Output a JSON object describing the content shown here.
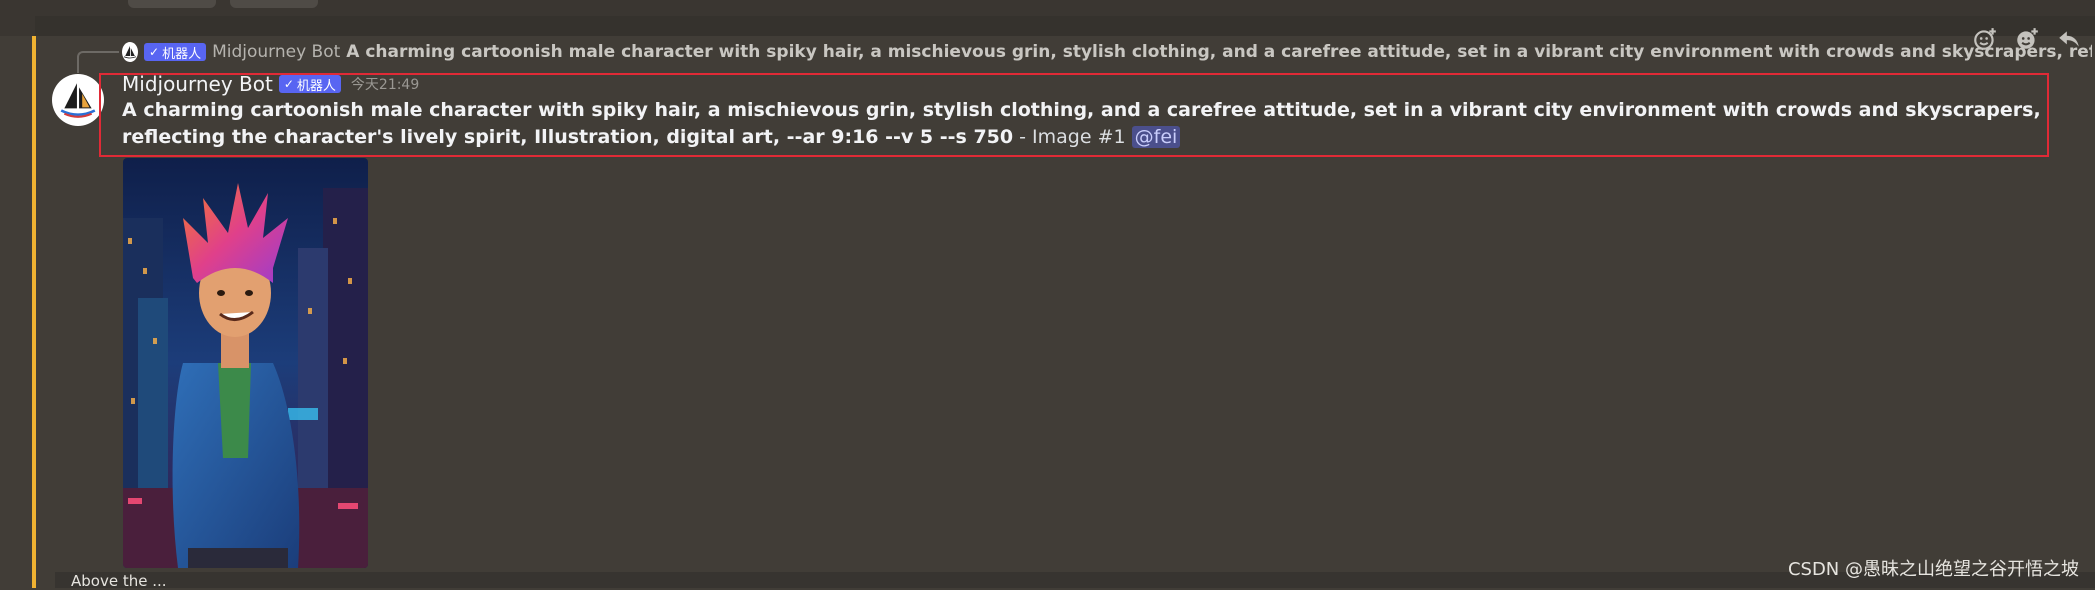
{
  "reply": {
    "author": "Midjourney Bot",
    "badge": "机器人",
    "text": "A charming cartoonish male character with spiky hair, a mischievous grin, stylish clothing, and a carefree attitude, set in a vibrant city environment with crowds and skyscrapers, reflecting the character's lively spirit, Illustration,"
  },
  "message": {
    "author": "Midjourney Bot",
    "badge": "机器人",
    "timestamp": "今天21:49",
    "prompt": "A charming cartoonish male character with spiky hair, a mischievous grin, stylish clothing, and a carefree attitude, set in a vibrant city environment with crowds and skyscrapers, reflecting the character's lively spirit, Illustration, digital art, --ar 9:16 --v 5 --s 750",
    "suffix": " - Image #1 ",
    "mention": "@fei"
  },
  "hover_actions": [
    {
      "icon": "add-reaction-icon"
    },
    {
      "icon": "super-reaction-icon"
    },
    {
      "icon": "reply-icon"
    }
  ],
  "input_partial": "Above the ...",
  "watermark": "CSDN @愚昧之山绝望之谷开悟之坡",
  "colors": {
    "background": "#413d37",
    "mention_bar": "#f0b232",
    "badge": "#5865f2",
    "highlight_border": "#e02a36"
  }
}
